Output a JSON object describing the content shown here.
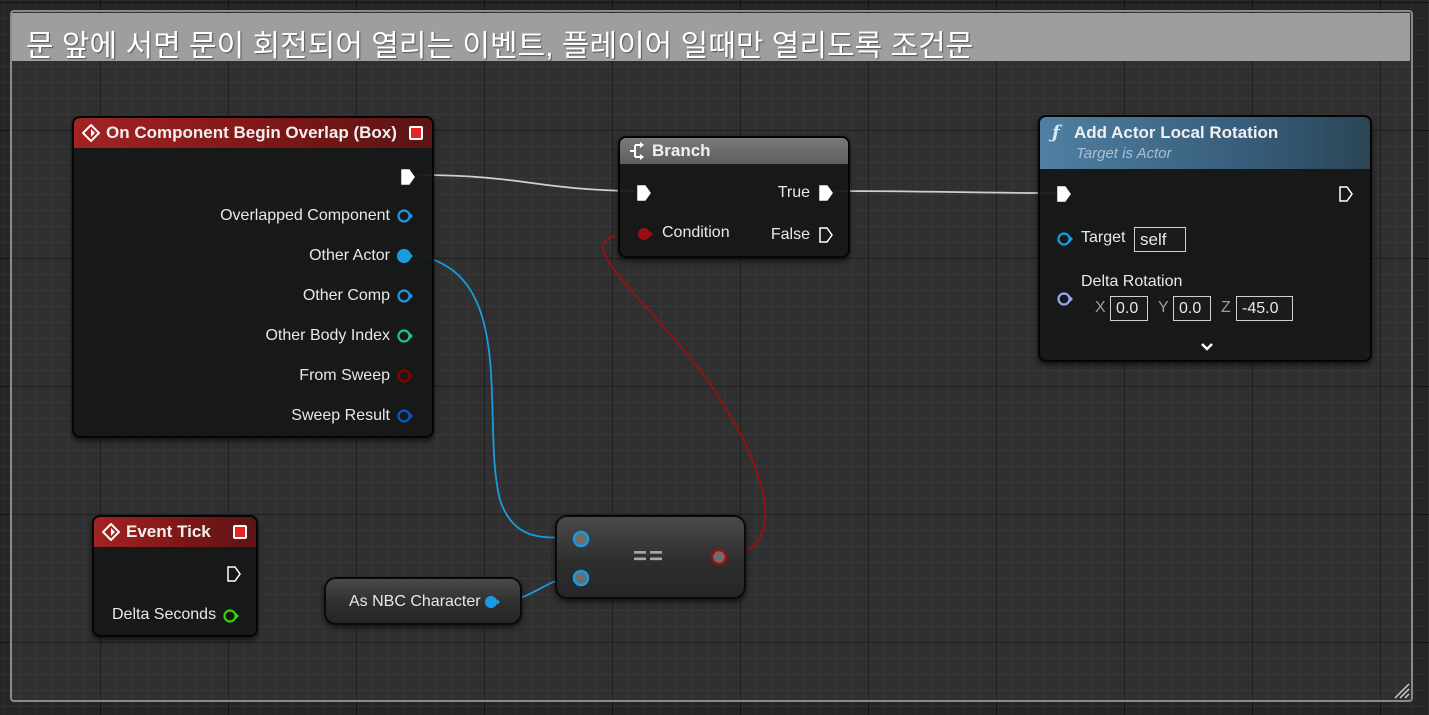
{
  "comment": {
    "title": "문 앞에 서면 문이 회전되어 열리는 이벤트, 플레이어 일때만 열리도록 조건문"
  },
  "nodes": {
    "overlap": {
      "title": "On Component Begin Overlap (Box)",
      "pins": [
        {
          "label": "Overlapped Component",
          "color": "#1a9be0"
        },
        {
          "label": "Other Actor",
          "color": "#1a9be0"
        },
        {
          "label": "Other Comp",
          "color": "#1a9be0"
        },
        {
          "label": "Other Body Index",
          "color": "#1ec497"
        },
        {
          "label": "From Sweep",
          "color": "#8c0000"
        },
        {
          "label": "Sweep Result",
          "color": "#0a58c8"
        }
      ]
    },
    "branch": {
      "title": "Branch",
      "condition_label": "Condition",
      "true_label": "True",
      "false_label": "False"
    },
    "rotation": {
      "title": "Add Actor Local Rotation",
      "subtitle": "Target is Actor",
      "target_label": "Target",
      "target_value": "self",
      "delta_label": "Delta Rotation",
      "x_axis": "X",
      "x_value": "0.0",
      "y_axis": "Y",
      "y_value": "0.0",
      "z_axis": "Z",
      "z_value": "-45.0"
    },
    "tick": {
      "title": "Event Tick",
      "delta_label": "Delta Seconds"
    },
    "cast": {
      "label": "As NBC Character"
    },
    "equal": {
      "symbol": "=="
    }
  },
  "colors": {
    "object_pin": "#1a9be0",
    "bool_pin": "#8c0000",
    "float_pin": "#38d10b",
    "exec_wire": "#d8d8d8",
    "rotator_pin": "#9ba3ff"
  }
}
